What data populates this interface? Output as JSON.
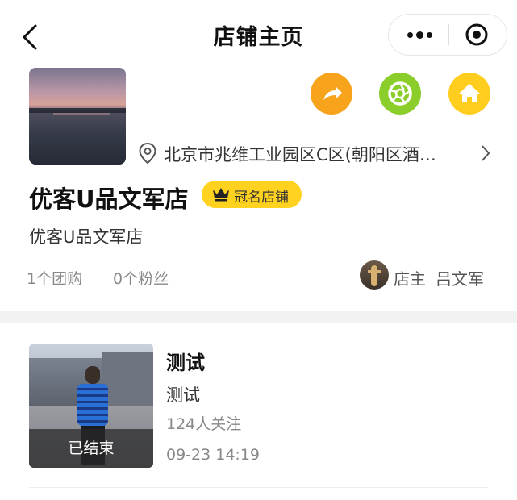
{
  "nav": {
    "title": "店铺主页",
    "back_icon": "chevron-left-icon",
    "more_icon": "more-dots-icon",
    "close_icon": "target-circle-icon"
  },
  "actions": {
    "share_icon": "share-arrow-icon",
    "share_color": "#f7a31b",
    "shutter_icon": "camera-shutter-icon",
    "shutter_color": "#8bcd2a",
    "home_icon": "home-icon",
    "home_color": "#ffcd1e"
  },
  "store": {
    "address": "北京市兆维工业园区C区(朝阳区酒…",
    "name": "优客U品文军店",
    "badge": "冠名店铺",
    "badge_color": "#ffd21f",
    "subtitle": "优客U品文军店",
    "group_buy_count": "1个团购",
    "fans_count": "0个粉丝",
    "owner_role": "店主",
    "owner_name": "吕文军"
  },
  "group_buys": [
    {
      "title": "测试",
      "description": "测试",
      "followers": "124人关注",
      "time": "09-23 14:19",
      "status": "已结束"
    }
  ]
}
